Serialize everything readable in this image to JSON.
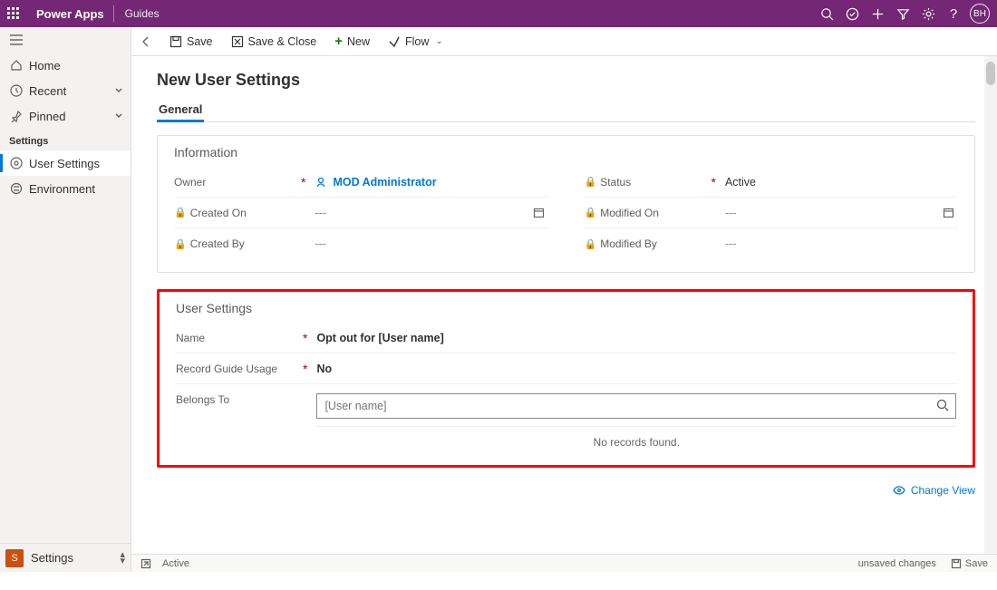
{
  "header": {
    "appname": "Power Apps",
    "area": "Guides",
    "avatar": "BH"
  },
  "sidebar": {
    "nav": {
      "home": "Home",
      "recent": "Recent",
      "pinned": "Pinned"
    },
    "section_label": "Settings",
    "items": {
      "user_settings": "User Settings",
      "environment": "Environment"
    },
    "footer_label": "Settings",
    "footer_tile": "S"
  },
  "cmdbar": {
    "save": "Save",
    "save_close": "Save & Close",
    "new": "New",
    "flow": "Flow"
  },
  "page": {
    "title": "New User Settings",
    "tab": "General"
  },
  "info_section": {
    "title": "Information",
    "owner_label": "Owner",
    "owner_value": "MOD Administrator",
    "status_label": "Status",
    "status_value": "Active",
    "created_on_label": "Created On",
    "created_on_value": "---",
    "modified_on_label": "Modified On",
    "modified_on_value": "---",
    "created_by_label": "Created By",
    "created_by_value": "---",
    "modified_by_label": "Modified By",
    "modified_by_value": "---"
  },
  "user_section": {
    "title": "User Settings",
    "name_label": "Name",
    "name_value": "Opt out for [User name]",
    "record_label": "Record Guide Usage",
    "record_value": "No",
    "belongs_label": "Belongs To",
    "belongs_placeholder": "[User name]",
    "no_records": "No records found.",
    "change_view": "Change View"
  },
  "statusbar": {
    "status": "Active",
    "unsaved": "unsaved changes",
    "save": "Save"
  }
}
